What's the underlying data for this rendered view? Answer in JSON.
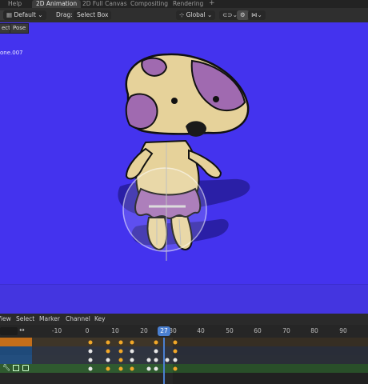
{
  "topbar": {
    "menu_help": "Help",
    "tabs": [
      {
        "label": "2D Animation",
        "active": true
      },
      {
        "label": "2D Full Canvas",
        "active": false
      },
      {
        "label": "Compositing",
        "active": false
      },
      {
        "label": "Rendering",
        "active": false
      }
    ],
    "add_tab": "+"
  },
  "header": {
    "layer_mode": "Default",
    "drag_label": "Drag:",
    "drag_value": "Select Box",
    "orientation": "Global"
  },
  "modes": {
    "select_partial": "ect",
    "pose": "Pose"
  },
  "viewport": {
    "object_label": "one.007",
    "background_color": "#4433ee"
  },
  "timeline": {
    "menu": [
      "View",
      "Select",
      "Marker",
      "Channel",
      "Key"
    ],
    "frame_ticks": [
      "-10",
      "0",
      "10",
      "20",
      "30",
      "40",
      "50",
      "60",
      "70",
      "80",
      "90"
    ],
    "current_frame": "27",
    "accent_color": "#4a7fd0"
  }
}
